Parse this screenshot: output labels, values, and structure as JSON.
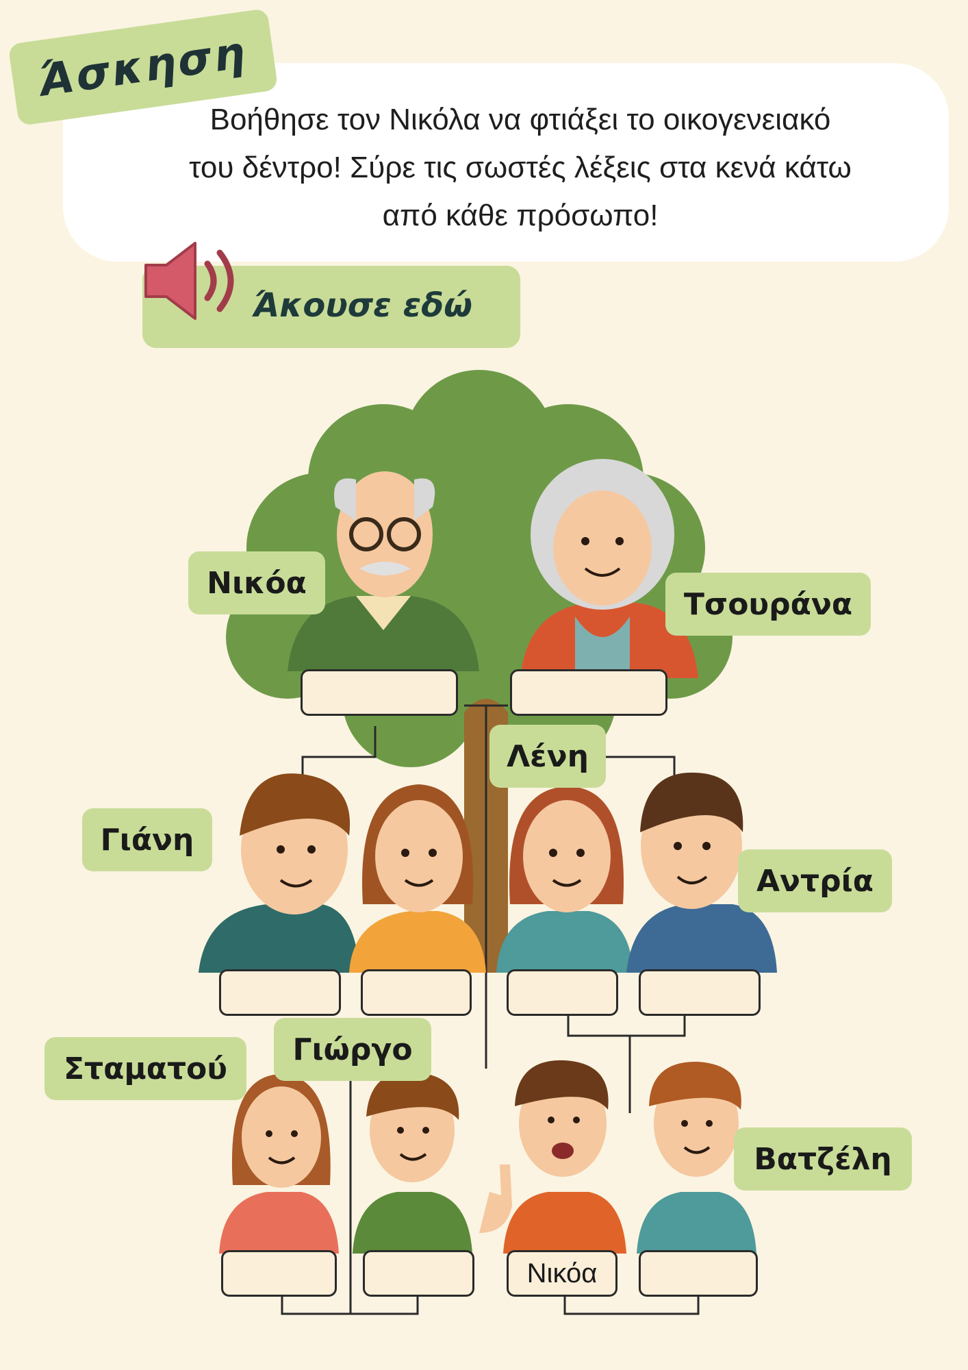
{
  "header": {
    "title": "Άσκηση"
  },
  "instructions": {
    "line1": "Βοήθησε τον Νικόλα να φτιάξει το οικογενειακό",
    "line2": "του δέντρο! Σύρε τις σωστές λέξεις στα κενά κάτω",
    "line3": "από κάθε πρόσωπο!"
  },
  "audio": {
    "label": "Άκουσε εδώ",
    "icon": "speaker-icon"
  },
  "word_chips": [
    "Νικόα",
    "Τσουράνα",
    "Λένη",
    "Γιάνη",
    "Αντρία",
    "Σταματού",
    "Γιώργο",
    "Βατζέλη"
  ],
  "slots": {
    "grandfather": "",
    "grandmother": "",
    "uncle": "",
    "aunt": "",
    "mother": "",
    "father": "",
    "cousin_girl": "",
    "cousin_boy": "",
    "nikolas": "Νικόα",
    "brother": ""
  },
  "colors": {
    "chip": "#c8dc98",
    "background": "#fbf4e2",
    "slot": "#fbefd9",
    "speaker": "#d45a6a",
    "tree": "#6e9a48"
  }
}
